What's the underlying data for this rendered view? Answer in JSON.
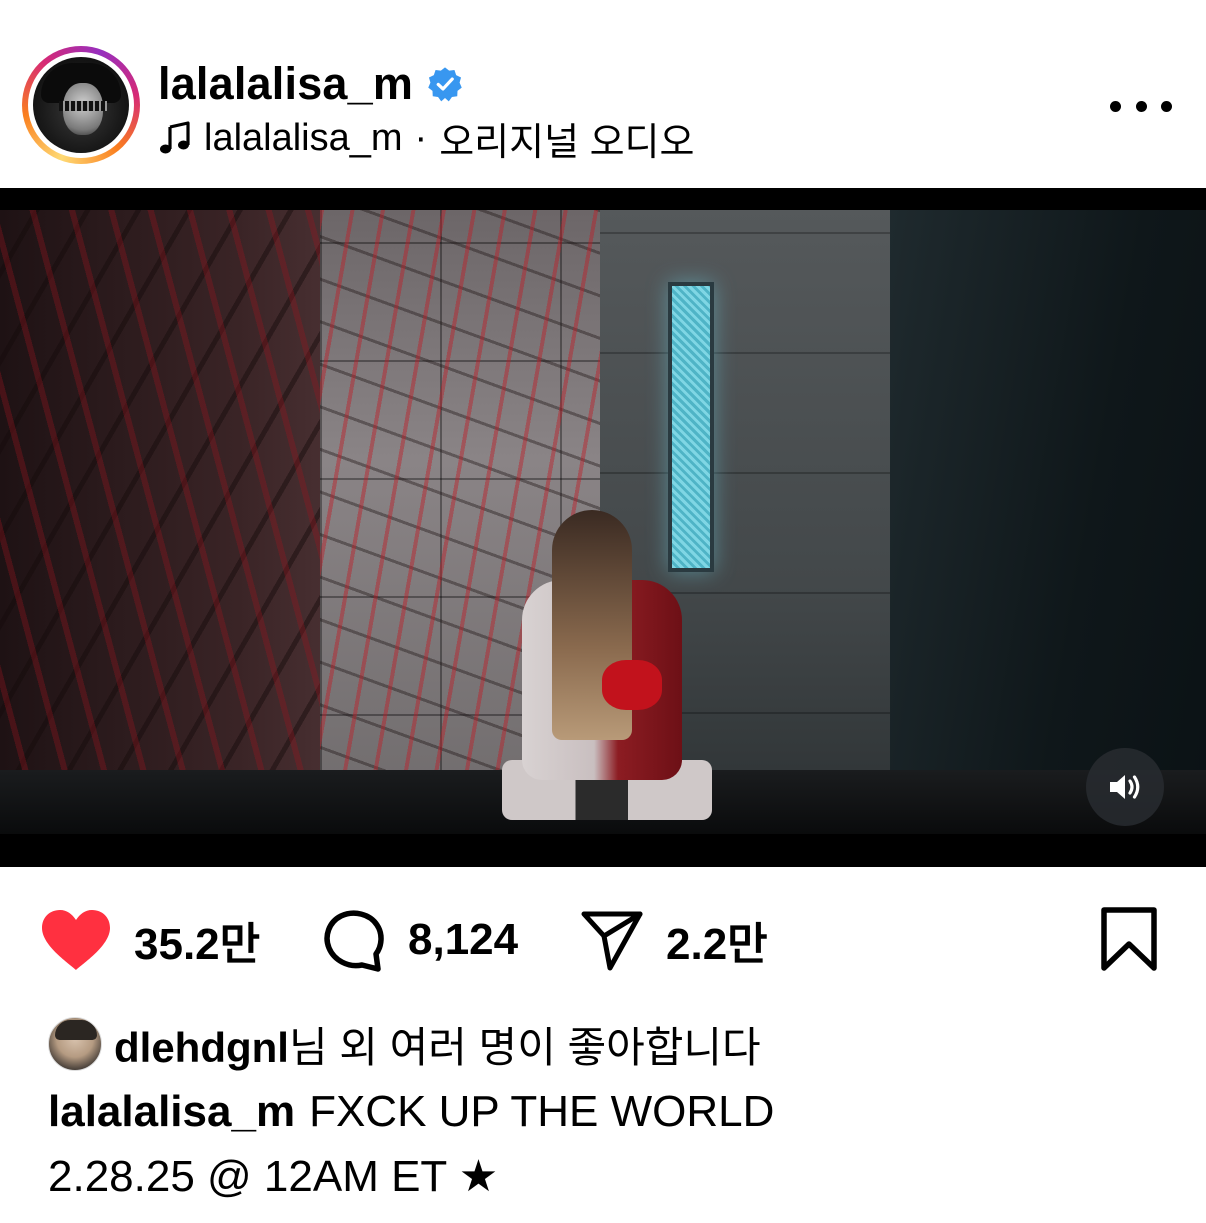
{
  "post": {
    "username": "lalalalisa_m",
    "verified": true,
    "audio": {
      "icon": "music-note-icon",
      "artist": "lalalalisa_m",
      "separator": "·",
      "title": "오리지널 오디오"
    },
    "more_icon": "more-horizontal-icon"
  },
  "media": {
    "type": "video",
    "mute_icon": "speaker-on-icon"
  },
  "actions": {
    "likes": "35.2만",
    "comments": "8,124",
    "shares": "2.2만",
    "liked": true,
    "like_color": "#ff3040",
    "bookmark_icon": "bookmark-icon"
  },
  "likes_summary": {
    "liker": "dlehdgnl",
    "suffix": "님 외 여러 명이 좋아합니다"
  },
  "caption": {
    "username": "lalalalisa_m",
    "line1": "FXCK UP THE WORLD",
    "line2": "2.28.25 @ 12AM ET ★"
  },
  "colors": {
    "verified_blue": "#3897f0",
    "text": "#000000",
    "background": "#ffffff"
  }
}
